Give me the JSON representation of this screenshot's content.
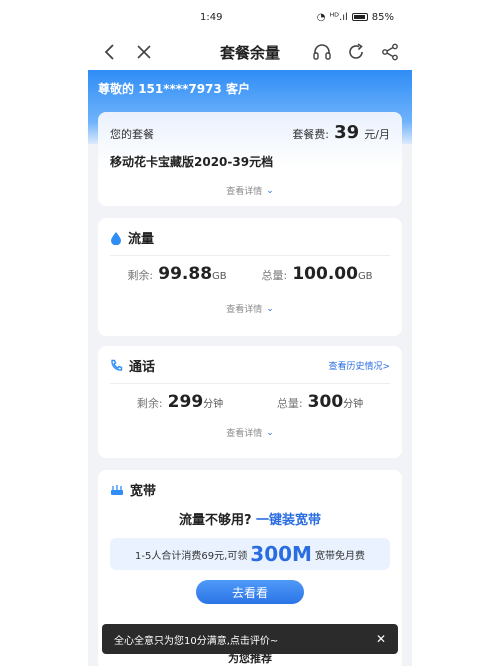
{
  "status_bar": {
    "time": "1:49",
    "signal": "ᴴᴰ.ıl",
    "battery": "85%"
  },
  "nav": {
    "title": "套餐余量"
  },
  "greeting": {
    "prefix": "尊敬的",
    "phone": "151****7973",
    "suffix": "客户"
  },
  "plan": {
    "label": "您的套餐",
    "fee_label": "套餐费:",
    "fee_value": "39",
    "fee_unit": "元/月",
    "name": "移动花卡宝藏版2020-39元档",
    "detail": "查看详情"
  },
  "data_section": {
    "title": "流量",
    "remaining_label": "剩余:",
    "remaining_value": "99.88",
    "remaining_unit": "GB",
    "total_label": "总量:",
    "total_value": "100.00",
    "total_unit": "GB",
    "detail": "查看详情"
  },
  "call_section": {
    "title": "通话",
    "history_link": "查看历史情况>",
    "remaining_label": "剩余:",
    "remaining_value": "299",
    "remaining_unit": "分钟",
    "total_label": "总量:",
    "total_value": "300",
    "total_unit": "分钟",
    "detail": "查看详情"
  },
  "broadband": {
    "title": "宽带",
    "promo_q": "流量不够用?",
    "promo_link": "一键装宽带",
    "offer_prefix": "1-5人合计消费69元,可领",
    "offer_big": "300M",
    "offer_suffix": "宽带免月费",
    "button": "去看看"
  },
  "recommend": "为您推荐",
  "toast": {
    "text": "全心全意只为您10分满意,点击评价~",
    "close": "✕"
  },
  "colors": {
    "accent": "#2a6de0",
    "banner": "#2f8df6"
  }
}
